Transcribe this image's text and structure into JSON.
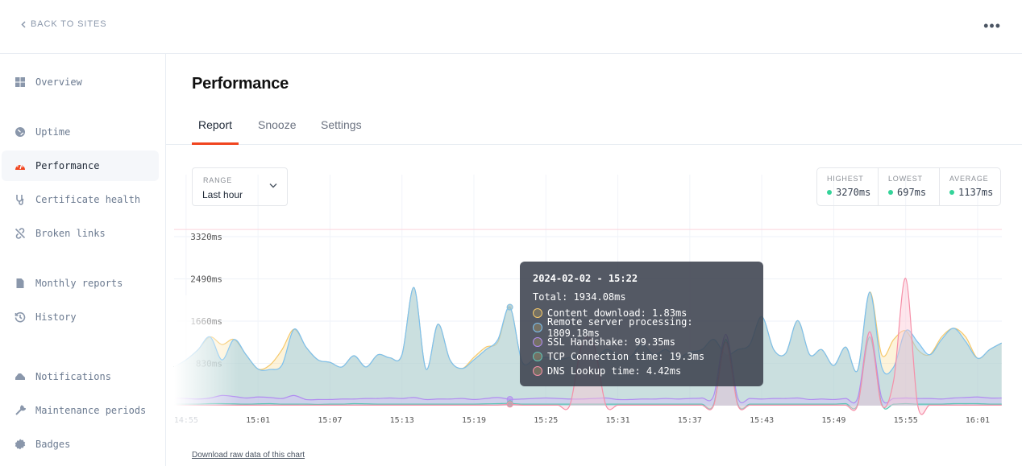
{
  "header": {
    "back_label": "BACK TO SITES",
    "more_icon": "ellipsis-icon"
  },
  "sidebar": {
    "items": [
      {
        "label": "Overview",
        "icon": "grid-icon"
      },
      {
        "label": "Uptime",
        "icon": "globe-icon"
      },
      {
        "label": "Performance",
        "icon": "gauge-icon",
        "active": true
      },
      {
        "label": "Certificate health",
        "icon": "stethoscope-icon"
      },
      {
        "label": "Broken links",
        "icon": "broken-link-icon"
      },
      {
        "label": "Monthly reports",
        "icon": "document-icon"
      },
      {
        "label": "History",
        "icon": "history-icon"
      },
      {
        "label": "Notifications",
        "icon": "megaphone-icon"
      },
      {
        "label": "Maintenance periods",
        "icon": "wrench-icon"
      },
      {
        "label": "Badges",
        "icon": "badge-icon"
      }
    ]
  },
  "page": {
    "title": "Performance",
    "tabs": [
      {
        "label": "Report",
        "active": true
      },
      {
        "label": "Snooze"
      },
      {
        "label": "Settings"
      }
    ],
    "range": {
      "label": "RANGE",
      "value": "Last hour"
    },
    "stats": [
      {
        "label": "HIGHEST",
        "value": "3270ms"
      },
      {
        "label": "LOWEST",
        "value": "697ms"
      },
      {
        "label": "AVERAGE",
        "value": "1137ms"
      }
    ],
    "download_label": "Download raw data of this chart",
    "accent_color": "#f0451f",
    "stat_dot_color": "#34d399"
  },
  "tooltip": {
    "date": "2024-02-02 - 15:22",
    "total": "Total: 1934.08ms",
    "rows": [
      {
        "text": "Content download: 1.83ms",
        "color": "#f5c86a"
      },
      {
        "text": "Remote server processing: 1809.18ms",
        "color": "#7cc0ef"
      },
      {
        "text": "SSL Handshake: 99.35ms",
        "color": "#b18cf0"
      },
      {
        "text": "TCP Connection time: 19.3ms",
        "color": "#5ec4b6"
      },
      {
        "text": "DNS Lookup time: 4.42ms",
        "color": "#f58fa8"
      }
    ]
  },
  "chart_data": {
    "type": "area",
    "y_ticks": [
      "3320ms",
      "2490ms",
      "1660ms",
      "830ms"
    ],
    "y_tick_values": [
      3320,
      2490,
      1660,
      830
    ],
    "ylim": [
      0,
      3500
    ],
    "x_ticks": [
      "14:55",
      "15:01",
      "15:07",
      "15:13",
      "15:19",
      "15:25",
      "15:31",
      "15:37",
      "15:43",
      "15:49",
      "15:55",
      "16:01"
    ],
    "x_start": "14:54",
    "x_step_minutes": 1,
    "grid": true,
    "threshold_ms": 3460,
    "highlight_time": "15:22",
    "series": [
      {
        "name": "Content download",
        "color": "#f5c86a",
        "values": [
          760,
          900,
          1100,
          1350,
          1200,
          1300,
          1000,
          720,
          800,
          1100,
          1500,
          1150,
          900,
          850,
          760,
          980,
          760,
          1000,
          940,
          1000,
          2320,
          720,
          1600,
          900,
          730,
          950,
          1150,
          1250,
          1934,
          870,
          900,
          950,
          900,
          950,
          1000,
          900,
          1100,
          1000,
          950,
          1200,
          1000,
          1100,
          950,
          1050,
          1100,
          1300,
          1000,
          1100,
          1200,
          1750,
          1100,
          1030,
          1670,
          1000,
          1100,
          790,
          1150,
          700,
          2230,
          1000,
          1300,
          1470,
          1100,
          1000,
          1350,
          1520,
          1350,
          930,
          1100,
          1230
        ]
      },
      {
        "name": "Remote server processing",
        "color": "#7cc0ef",
        "values": [
          760,
          900,
          1100,
          1350,
          900,
          1300,
          1000,
          720,
          710,
          800,
          1500,
          1150,
          900,
          850,
          760,
          980,
          760,
          1000,
          940,
          1000,
          2320,
          720,
          1600,
          900,
          730,
          900,
          1100,
          1300,
          1934,
          870,
          900,
          950,
          900,
          950,
          1000,
          900,
          1100,
          1000,
          950,
          1200,
          1000,
          1100,
          950,
          1050,
          1100,
          1300,
          1000,
          1100,
          1200,
          1750,
          1100,
          1030,
          1670,
          1000,
          1100,
          790,
          1150,
          700,
          2230,
          760,
          760,
          1470,
          1250,
          1000,
          1300,
          1520,
          1260,
          930,
          1100,
          1230
        ]
      },
      {
        "name": "SSL Handshake",
        "color": "#b18cf0",
        "values": [
          150,
          140,
          130,
          150,
          200,
          180,
          150,
          170,
          160,
          140,
          200,
          120,
          120,
          120,
          130,
          130,
          140,
          140,
          150,
          140,
          160,
          120,
          130,
          130,
          140,
          120,
          140,
          160,
          125,
          130,
          140,
          150,
          140,
          130,
          130,
          140,
          150,
          120,
          120,
          130,
          130,
          140,
          130,
          140,
          150,
          200,
          1400,
          150,
          140,
          130,
          140,
          140,
          150,
          120,
          130,
          120,
          140,
          150,
          1450,
          150,
          140,
          150,
          140,
          140,
          130,
          150,
          160,
          170,
          150,
          150
        ]
      },
      {
        "name": "TCP Connection time",
        "color": "#5ec4b6",
        "values": [
          30,
          30,
          30,
          40,
          40,
          35,
          30,
          35,
          40,
          30,
          30,
          30,
          25,
          30,
          30,
          40,
          35,
          30,
          30,
          30,
          30,
          30,
          30,
          30,
          30,
          30,
          35,
          40,
          44,
          30,
          30,
          30,
          30,
          30,
          30,
          30,
          30,
          30,
          30,
          30,
          30,
          30,
          30,
          30,
          30,
          30,
          1300,
          30,
          30,
          30,
          30,
          30,
          30,
          30,
          30,
          30,
          40,
          30,
          1350,
          30,
          30,
          40,
          30,
          30,
          30,
          40,
          40,
          40,
          30,
          30
        ]
      },
      {
        "name": "DNS Lookup time",
        "color": "#f58fa8",
        "values": [
          10,
          10,
          10,
          10,
          10,
          10,
          10,
          10,
          10,
          10,
          10,
          10,
          10,
          10,
          10,
          10,
          10,
          10,
          10,
          10,
          10,
          10,
          10,
          10,
          10,
          10,
          10,
          10,
          25,
          10,
          10,
          10,
          10,
          10,
          1200,
          1200,
          10,
          10,
          10,
          10,
          10,
          10,
          10,
          10,
          10,
          10,
          1250,
          10,
          10,
          10,
          10,
          10,
          10,
          10,
          10,
          10,
          10,
          10,
          1450,
          10,
          500,
          2500,
          10,
          10,
          10,
          10,
          10,
          10,
          10,
          10
        ]
      }
    ]
  }
}
